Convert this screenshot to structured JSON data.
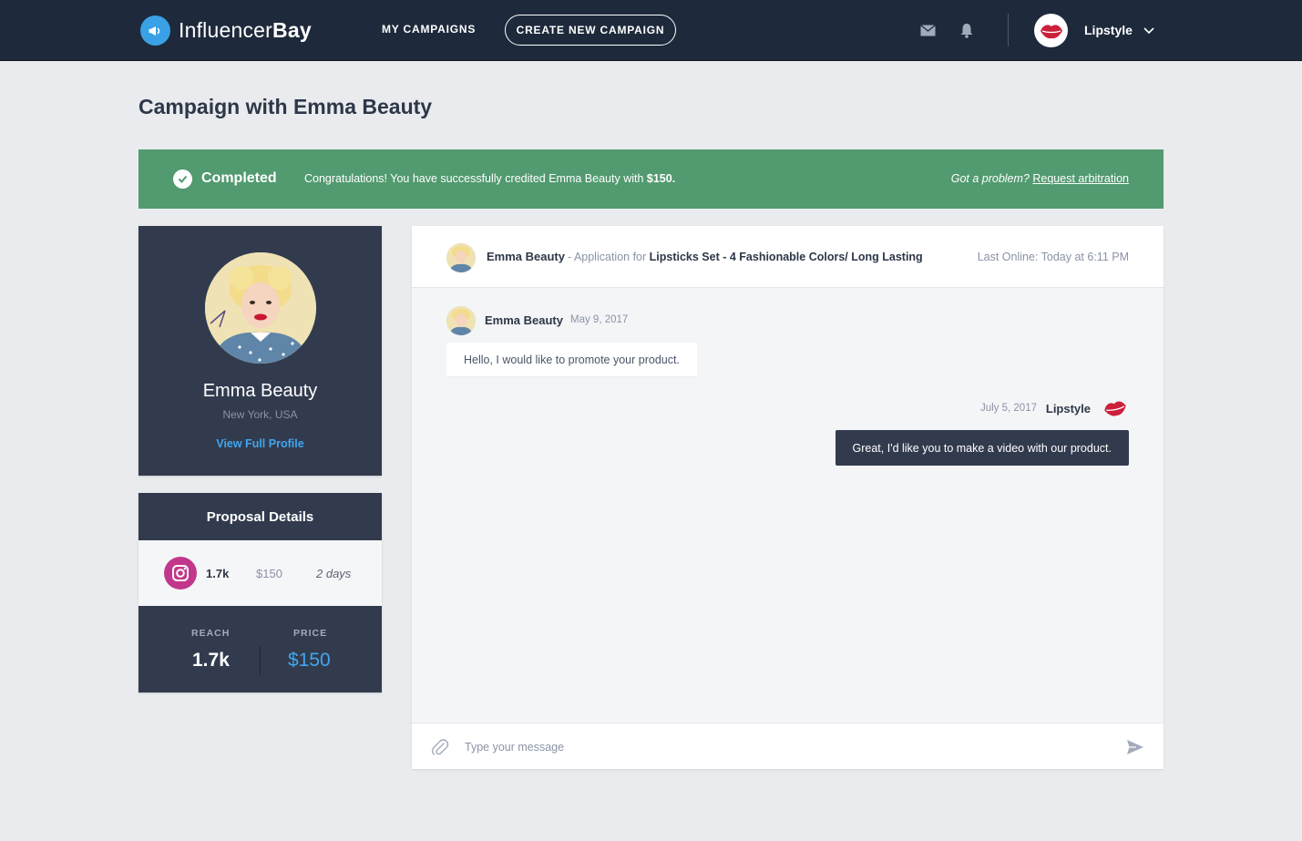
{
  "brand": {
    "name_light": "Influencer",
    "name_bold": "Bay"
  },
  "nav": {
    "my_campaigns": "MY CAMPAIGNS",
    "create_campaign": "CREATE NEW CAMPAIGN",
    "user_name": "Lipstyle"
  },
  "page": {
    "title": "Campaign with Emma Beauty"
  },
  "banner": {
    "status": "Completed",
    "message": "Congratulations! You have successfully credited Emma Beauty with ",
    "amount": "$150.",
    "problem_text": "Got a problem?",
    "arbitration_link": "Request arbitration",
    "color": "#529a70"
  },
  "profile": {
    "name": "Emma Beauty",
    "location": "New York, USA",
    "link": "View Full Profile"
  },
  "proposal": {
    "title": "Proposal Details",
    "platform": "instagram",
    "reach": "1.7k",
    "price": "$150",
    "duration": "2 days",
    "reach_label": "REACH",
    "price_label": "PRICE",
    "reach_value": "1.7k",
    "price_value": "$150"
  },
  "chat": {
    "header": {
      "name": "Emma Beauty",
      "application_prefix": "- Application for ",
      "product": "Lipsticks Set - 4 Fashionable Colors/ Long Lasting",
      "last_online": "Last Online: Today at 6:11 PM"
    },
    "messages": [
      {
        "sender": "Emma Beauty",
        "date": "May 9, 2017",
        "text": "Hello, I would like to promote your product.",
        "direction": "incoming"
      },
      {
        "sender": "Lipstyle",
        "date": "July 5, 2017",
        "text": "Great, I'd like you to make a video with our product.",
        "direction": "outgoing"
      }
    ],
    "composer_placeholder": "Type your message"
  },
  "colors": {
    "nav_bg": "#1e2a3b",
    "accent": "#41a6ee",
    "card_bg": "#323b4e",
    "instagram": "#c2378b"
  }
}
